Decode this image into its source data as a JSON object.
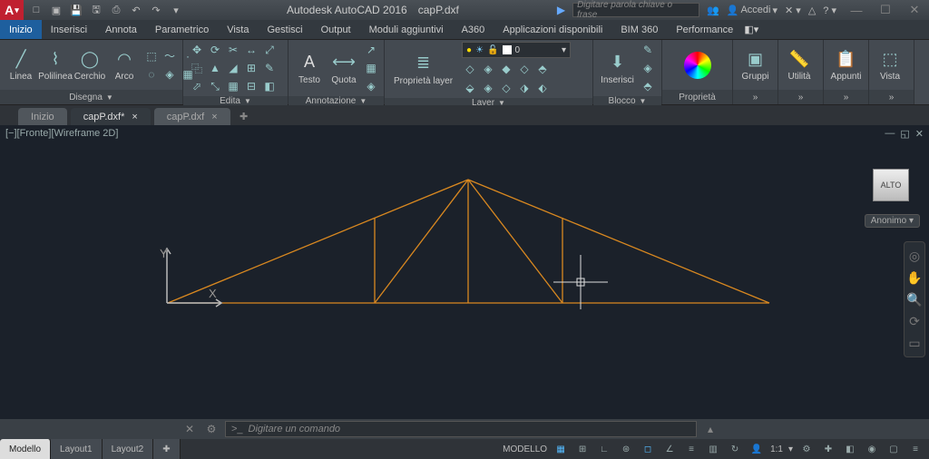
{
  "title": {
    "app": "Autodesk AutoCAD 2016",
    "doc": "capP.dxf"
  },
  "search": {
    "placeholder": "Digitare parola chiave o frase"
  },
  "signin": {
    "label": "Accedi"
  },
  "qat": {
    "new": "□",
    "open": "▣",
    "save": "💾",
    "saveas": "🖫",
    "plot": "⎙",
    "undo": "↶",
    "redo": "↷"
  },
  "menus": {
    "items": [
      "Inizio",
      "Inserisci",
      "Annota",
      "Parametrico",
      "Vista",
      "Gestisci",
      "Output",
      "Moduli aggiuntivi",
      "A360",
      "Applicazioni disponibili",
      "BIM 360",
      "Performance"
    ]
  },
  "ribbon": {
    "disegna": {
      "title": "Disegna",
      "linea": "Linea",
      "polilinea": "Polilinea",
      "cerchio": "Cerchio",
      "arco": "Arco"
    },
    "edita": {
      "title": "Edita"
    },
    "annotazione": {
      "title": "Annotazione",
      "testo": "Testo",
      "quota": "Quota"
    },
    "layer": {
      "title": "Layer",
      "proprieta": "Proprietà\nlayer",
      "current": "0"
    },
    "blocco": {
      "title": "Blocco",
      "inserisci": "Inserisci"
    },
    "proprieta": {
      "title": "Proprietà",
      "label": "Proprietà"
    },
    "gruppi": {
      "title": "",
      "label": "Gruppi"
    },
    "utilita": {
      "title": "",
      "label": "Utilità"
    },
    "appunti": {
      "title": "",
      "label": "Appunti"
    },
    "vista": {
      "title": "",
      "label": "Vista"
    }
  },
  "filetabs": {
    "items": [
      {
        "label": "Inizio",
        "close": ""
      },
      {
        "label": "capP.dxf*",
        "close": "×"
      },
      {
        "label": "capP.dxf",
        "close": "×"
      }
    ],
    "active": 1
  },
  "viewport": {
    "label": "[−][Fronte][Wireframe 2D]",
    "cube": "ALTO",
    "anonimo": "Anonimo"
  },
  "axes": {
    "x": "X",
    "y": "Y"
  },
  "cmd": {
    "placeholder": "Digitare un comando",
    "prompt": ">_"
  },
  "status": {
    "tabs": [
      "Modello",
      "Layout1",
      "Layout2"
    ],
    "active": 0,
    "model_label": "MODELLO",
    "scale": "1:1"
  }
}
